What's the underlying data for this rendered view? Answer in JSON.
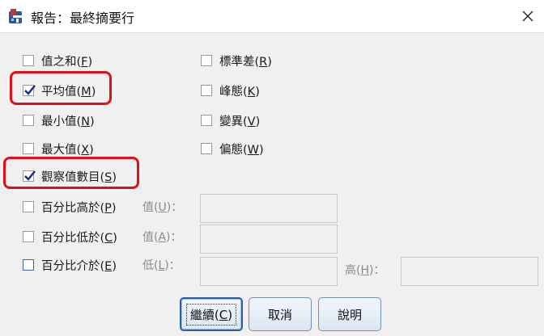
{
  "window": {
    "title": "報告：最終摘要行"
  },
  "options": {
    "sum": {
      "label": "值之和",
      "key": "F",
      "checked": false
    },
    "mean": {
      "label": "平均值",
      "key": "M",
      "checked": true
    },
    "min": {
      "label": "最小值",
      "key": "N",
      "checked": false
    },
    "max": {
      "label": "最大值",
      "key": "X",
      "checked": false
    },
    "count": {
      "label": "觀察值數目",
      "key": "S",
      "checked": true
    },
    "stddev": {
      "label": "標準差",
      "key": "R",
      "checked": false
    },
    "kurtosis": {
      "label": "峰態",
      "key": "K",
      "checked": false
    },
    "variance": {
      "label": "變異",
      "key": "V",
      "checked": false
    },
    "skewness": {
      "label": "偏態",
      "key": "W",
      "checked": false
    },
    "pct_above": {
      "label": "百分比高於",
      "key": "P",
      "checked": false
    },
    "pct_below": {
      "label": "百分比低於",
      "key": "C",
      "checked": false
    },
    "pct_inside": {
      "label": "百分比介於",
      "key": "E",
      "checked": false
    }
  },
  "fields": {
    "value_label": "值",
    "value_key": "U",
    "value2_label": "值",
    "value2_key": "A",
    "low_label": "低",
    "low_key": "L",
    "high_label": "高",
    "high_key": "H",
    "colon": "："
  },
  "buttons": {
    "continue": {
      "label": "繼續",
      "key": "C"
    },
    "cancel": {
      "label": "取消"
    },
    "help": {
      "label": "說明"
    }
  },
  "colors": {
    "highlight": "#e0101b",
    "check": "#1b2a8a"
  }
}
